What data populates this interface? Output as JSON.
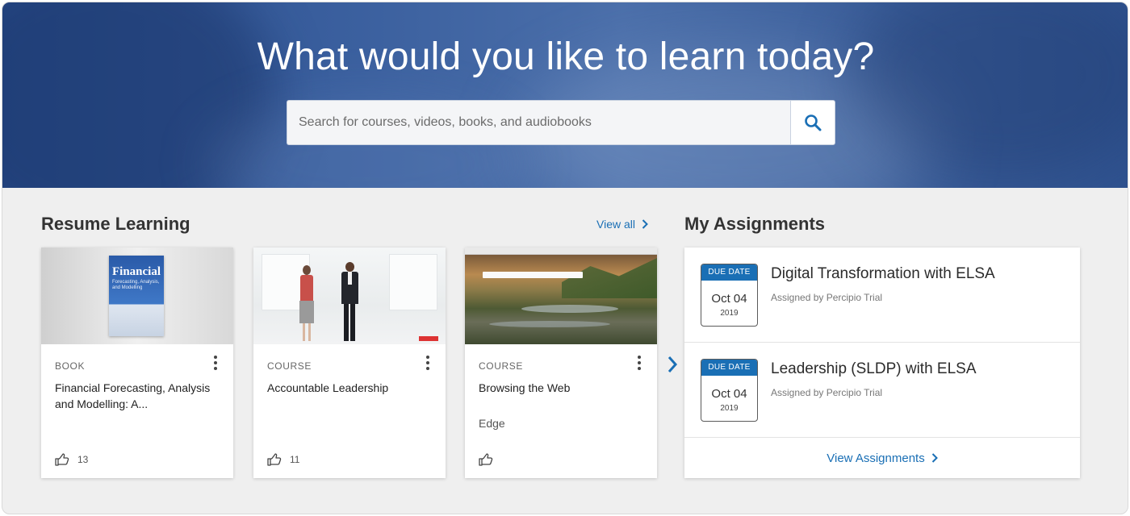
{
  "hero": {
    "title": "What would you like to learn today?",
    "search_placeholder": "Search for courses, videos, books, and audiobooks",
    "search_icon": "search-icon"
  },
  "resume": {
    "title": "Resume Learning",
    "view_all": "View all",
    "cards": [
      {
        "type": "BOOK",
        "title": "Financial Forecasting, Analysis and Modelling: A...",
        "subtitle": "",
        "likes": "13",
        "thumb_text": "Financial",
        "thumb_subtext": "Forecasting, Analysis, and Modelling"
      },
      {
        "type": "COURSE",
        "title": "Accountable Leadership",
        "subtitle": "",
        "likes": "11"
      },
      {
        "type": "COURSE",
        "title": "Browsing the Web",
        "subtitle": "Edge",
        "likes": ""
      }
    ]
  },
  "assignments": {
    "title": "My Assignments",
    "items": [
      {
        "due_label": "DUE DATE",
        "date": "Oct 04",
        "year": "2019",
        "title": "Digital Transformation with ELSA",
        "assigned_by": "Assigned by Percipio Trial"
      },
      {
        "due_label": "DUE DATE",
        "date": "Oct 04",
        "year": "2019",
        "title": "Leadership (SLDP) with ELSA",
        "assigned_by": "Assigned by Percipio Trial"
      }
    ],
    "view_all": "View Assignments"
  },
  "colors": {
    "accent": "#1a6fb5",
    "hero": "#3a5f9e",
    "background": "#efefef"
  }
}
